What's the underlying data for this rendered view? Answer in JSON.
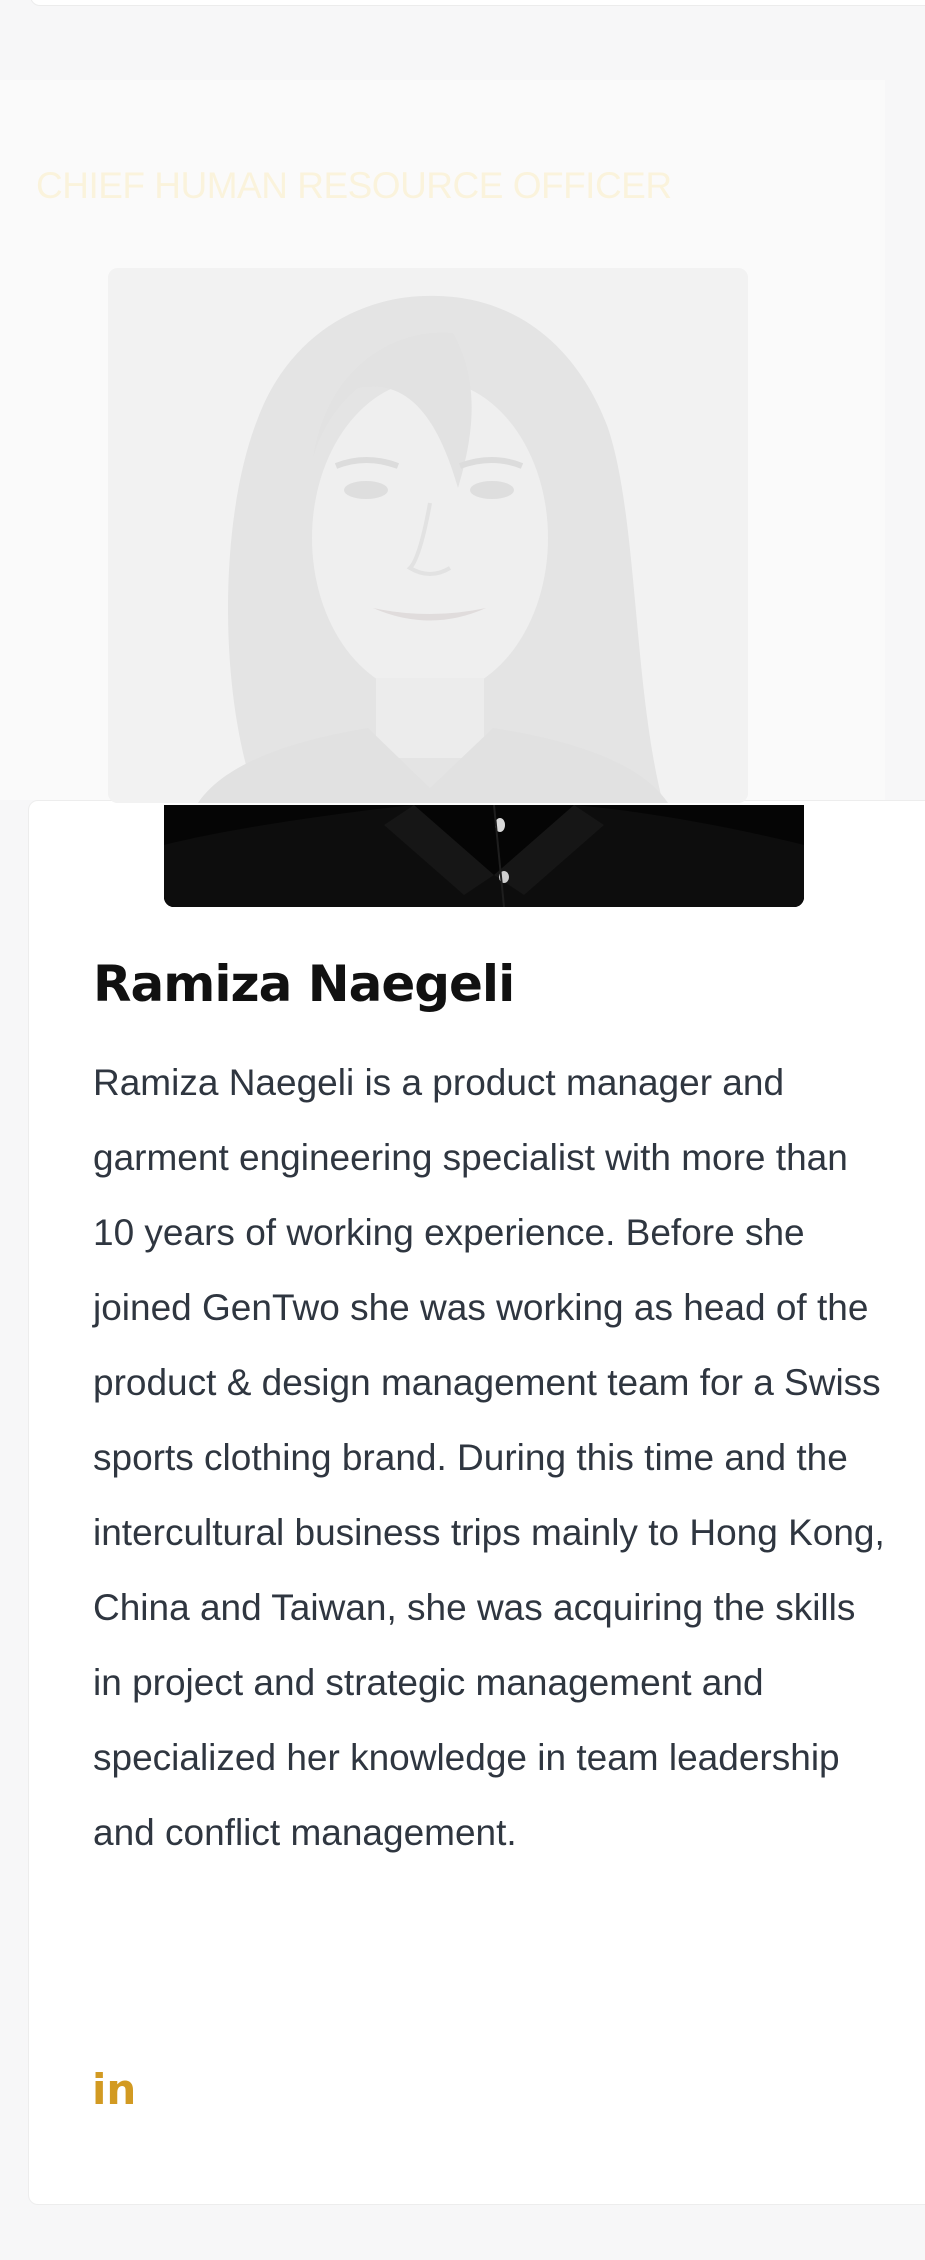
{
  "member": {
    "job_title": "CHIEF HUMAN RESOURCE OFFICER",
    "name": "Ramiza Naegeli",
    "bio": "Ramiza Naegeli is a product manager and garment engineering specialist with more than 10 years of working experience. Before she joined GenTwo she was working as head of the product & design management team for a Swiss sports clothing brand. During this time and the intercultural business trips mainly to Hong Kong, China and Taiwan, she was acquiring the skills in project and strategic management and specialized her knowledge in team leadership and conflict management.",
    "photo_alt": "Ramiza Naegeli",
    "linkedin_label": "in",
    "linkedin_icon": "linkedin-icon"
  },
  "colors": {
    "accent": "#d29a22",
    "job_title_faded": "#faf3dc",
    "text": "#2f3640",
    "name": "#111111"
  }
}
